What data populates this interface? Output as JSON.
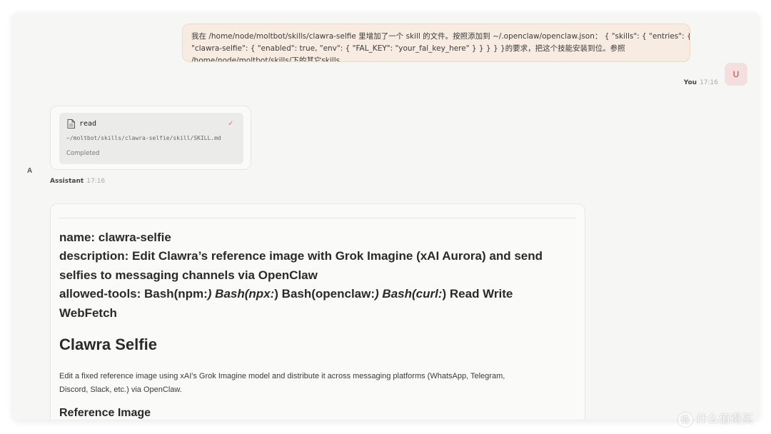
{
  "user_message": {
    "lines": [
      "我在 /home/node/moltbot/skills/clawra-selfie 里增加了一个 skill 的文件。按照添加到 ~/.openclaw/openclaw.json： { \"skills\": { \"entries\": {",
      "\"clawra-selfie\": { \"enabled\": true, \"env\": { \"FAL_KEY\": \"your_fal_key_here\" } } } } }的要求，把这个技能安装到位。参照",
      "/home/node/moltbot/skills/下的其它skills"
    ],
    "sender": "You",
    "time": "17:16",
    "avatar": "U"
  },
  "tool_call": {
    "icon": "document-icon",
    "name": "read",
    "path": "~/moltbot/skills/clawra-selfie/skill/SKILL.md",
    "status": "Completed"
  },
  "assistant": {
    "avatar": "A",
    "sender": "Assistant",
    "time": "17:16"
  },
  "content": {
    "fm_name": "name: clawra-selfie",
    "fm_desc_1": "description: Edit Clawra’s reference image with Grok Imagine (xAI Aurora) and send",
    "fm_desc_2": "selfies to messaging channels via OpenClaw",
    "fm_tools_a": "allowed-tools: Bash(npm:",
    "fm_tools_b": ") Bash(npx:",
    "fm_tools_c": ") Bash(openclaw:",
    "fm_tools_d": ") Bash(curl:",
    "fm_tools_e": ") Read Write",
    "fm_tools_f": "WebFetch",
    "heading": "Clawra Selfie",
    "paragraph_1": "Edit a fixed reference image using xAI's Grok Imagine model and distribute it across messaging platforms (WhatsApp, Telegram,",
    "paragraph_2": "Discord, Slack, etc.) via OpenClaw.",
    "subheading": "Reference Image"
  },
  "watermark": "什么值得买"
}
